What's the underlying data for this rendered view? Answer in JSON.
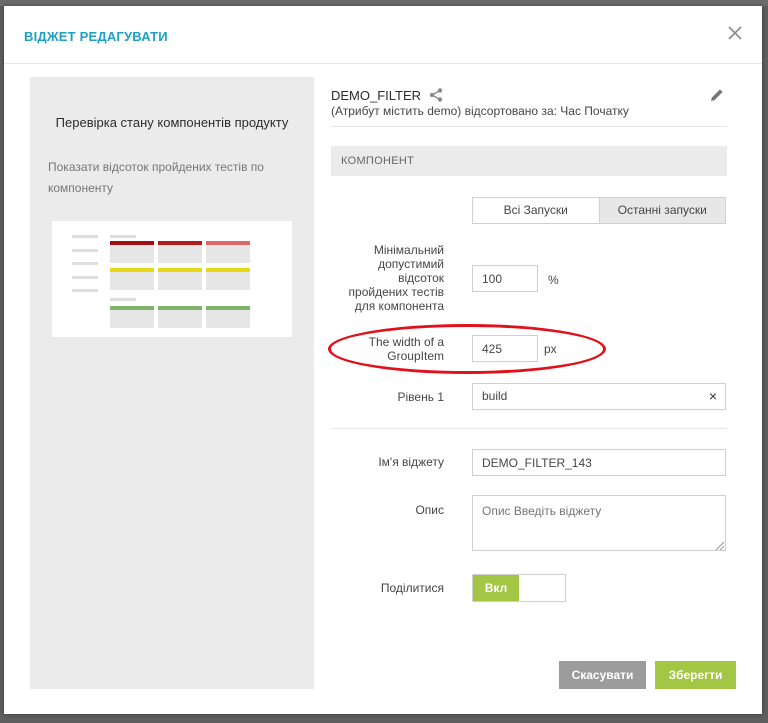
{
  "modal": {
    "title": "ВІДЖЕТ РЕДАГУВАТИ"
  },
  "preview": {
    "title": "Перевірка стану компонентів продукту",
    "description": "Показати відсоток пройдених тестів по компоненту"
  },
  "widget": {
    "name": "DEMO_FILTER",
    "subtitle": "(Атрибут містить demo) відсортовано за: Час Початку"
  },
  "section": {
    "label": "КОМПОНЕНТ"
  },
  "tabs": [
    {
      "label": "Всі Запуски",
      "active": true
    },
    {
      "label": "Останні запуски",
      "active": false
    }
  ],
  "fields": {
    "min_percent": {
      "label": "Мінімальний допустимий відсоток пройдених тестів для компонента",
      "value": "100",
      "unit": "%"
    },
    "group_width": {
      "label": "The width of a GroupItem",
      "value": "425",
      "unit": "px"
    },
    "level": {
      "label": "Рівень 1",
      "value": "build",
      "clear": "×"
    },
    "widget_name": {
      "label": "Ім'я віджету",
      "value": "DEMO_FILTER_143"
    },
    "description": {
      "label": "Опис",
      "placeholder": "Опис Введіть віджету"
    },
    "share": {
      "label": "Поділитися",
      "state": "Вкл"
    }
  },
  "buttons": {
    "cancel": "Скасувати",
    "save": "Зберегти"
  },
  "colors": {
    "accent": "#1ea0c4",
    "green": "#a3c644",
    "annotation_red": "#e0111b"
  }
}
